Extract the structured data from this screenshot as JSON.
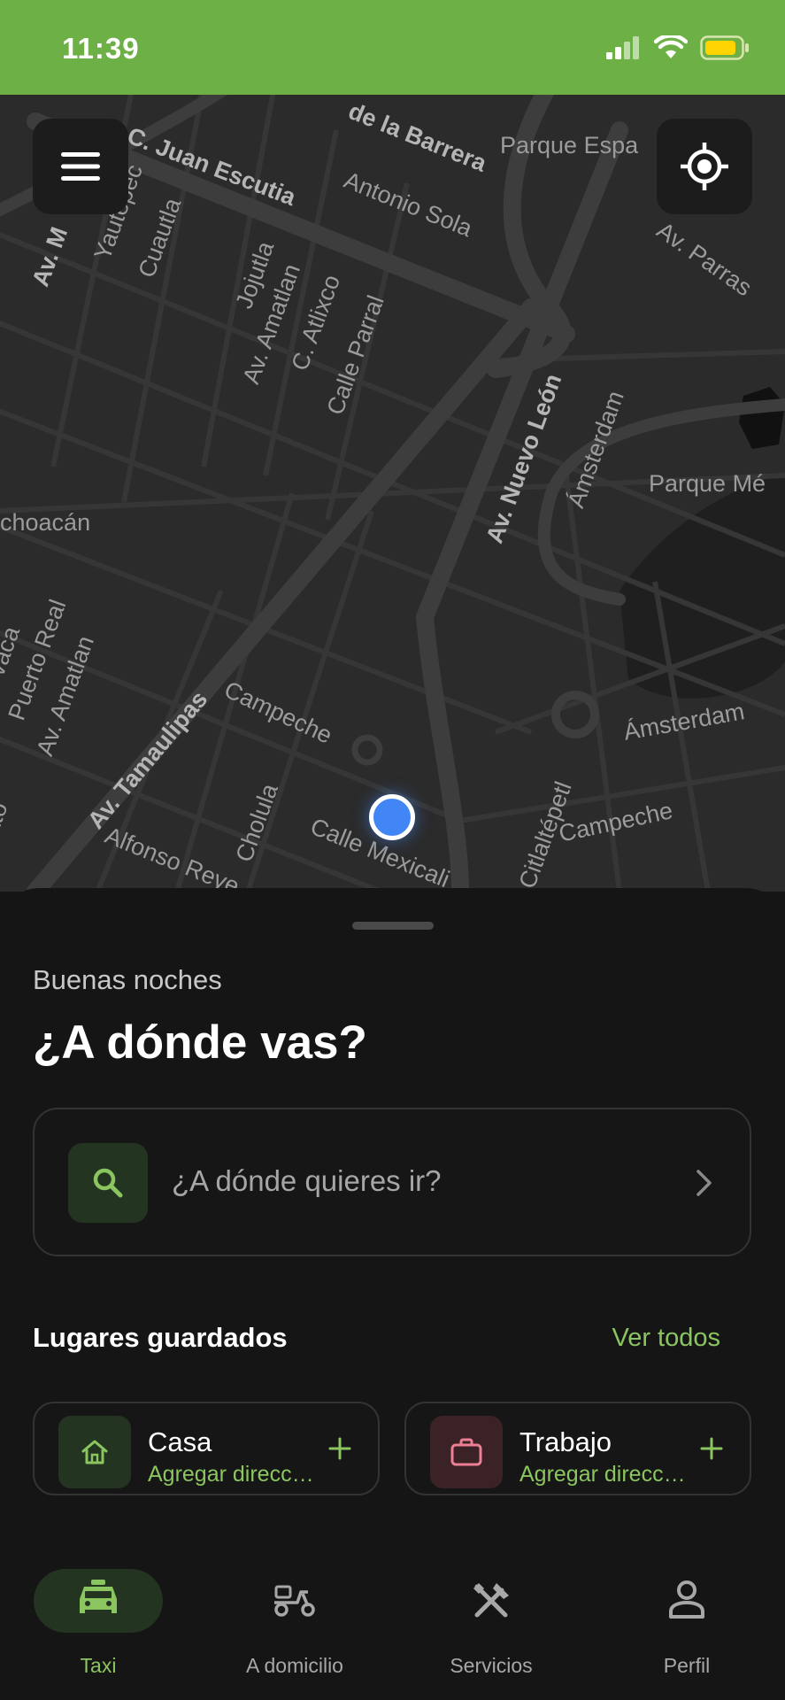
{
  "status_bar": {
    "time": "11:39",
    "color": "#6db046"
  },
  "map": {
    "street_labels": [
      "C. Juan Escutia",
      "de la Barrera",
      "Parque Espa",
      "Antonio Sola",
      "Av. Parras",
      "Av. M",
      "Yautepec",
      "Cuautla",
      "Jojutla",
      "Av. Amatlan",
      "C. Atlixco",
      "Calle Parral",
      "Av. Nuevo León",
      "Ámsterdam",
      "Parque Mé",
      "choacán",
      "Puerto Real",
      "Av. Amatlan",
      "Av. Tamaulipas",
      "Campeche",
      "Ámsterdam",
      "Cholula",
      "Calle Mexicali",
      "Alfonso Reye",
      "Citlaltépetl",
      "Campeche",
      "vaca",
      "ato"
    ],
    "menu_icon": "hamburger-menu-icon",
    "locate_icon": "crosshair-locate-icon",
    "user_location_color": "#4285f4"
  },
  "sheet": {
    "greeting": "Buenas noches",
    "headline": "¿A dónde vas?",
    "search": {
      "placeholder": "¿A dónde quieres ir?",
      "icon": "search-icon"
    },
    "saved": {
      "title": "Lugares guardados",
      "link": "Ver todos",
      "places": [
        {
          "name": "Casa",
          "subtitle": "Agregar dirección",
          "icon": "home-icon",
          "accent": "#233520"
        },
        {
          "name": "Trabajo",
          "subtitle": "Agregar dirección",
          "icon": "briefcase-icon",
          "accent": "#3a2226"
        }
      ]
    }
  },
  "nav": {
    "items": [
      {
        "label": "Taxi",
        "icon": "taxi-icon",
        "active": true
      },
      {
        "label": "A domicilio",
        "icon": "scooter-icon",
        "active": false
      },
      {
        "label": "Servicios",
        "icon": "tools-icon",
        "active": false
      },
      {
        "label": "Perfil",
        "icon": "person-icon",
        "active": false
      }
    ]
  },
  "colors": {
    "accent": "#8bc55f",
    "background": "#151515"
  }
}
